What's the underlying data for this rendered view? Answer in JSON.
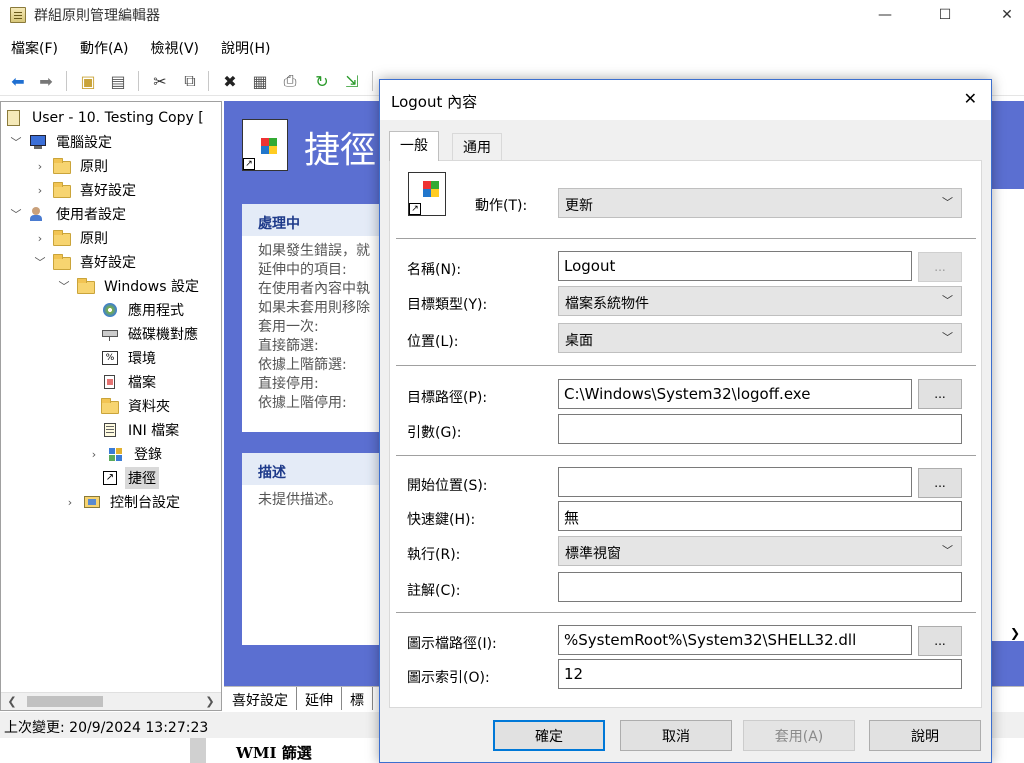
{
  "window": {
    "title": "群組原則管理編輯器"
  },
  "menu": [
    "檔案(F)",
    "動作(A)",
    "檢視(V)",
    "說明(H)"
  ],
  "tree": {
    "root": "User - 10. Testing Copy [",
    "items": [
      "電腦設定",
      "原則",
      "喜好設定",
      "使用者設定",
      "原則",
      "喜好設定",
      "Windows 設定",
      "應用程式",
      "磁碟機對應",
      "環境",
      "檔案",
      "資料夾",
      "INI 檔案",
      "登錄",
      "捷徑",
      "控制台設定"
    ]
  },
  "content": {
    "heading": "捷徑",
    "processing_title": "處理中",
    "processing_lines": [
      "如果發生錯誤，就",
      "延伸中的項目:",
      "在使用者內容中執",
      "如果未套用則移除",
      "套用一次:",
      "直接篩選:",
      "依據上階篩選:",
      "直接停用:",
      "依據上階停用:"
    ],
    "desc_title": "描述",
    "desc_text": "未提供描述。"
  },
  "bottom_tabs": [
    "喜好設定",
    "延伸",
    "標"
  ],
  "status": "上次變更: 20/9/2024 13:27:23",
  "wmi": "WMI 篩選",
  "dialog": {
    "title": "Logout 內容",
    "tabs": [
      "一般",
      "通用"
    ],
    "action_label": "動作(T):",
    "action_value": "更新",
    "name_label": "名稱(N):",
    "name_value": "Logout",
    "target_type_label": "目標類型(Y):",
    "target_type_value": "檔案系統物件",
    "location_label": "位置(L):",
    "location_value": "桌面",
    "target_path_label": "目標路徑(P):",
    "target_path_value": "C:\\Windows\\System32\\logoff.exe",
    "args_label": "引數(G):",
    "args_value": "",
    "start_in_label": "開始位置(S):",
    "start_in_value": "",
    "hotkey_label": "快速鍵(H):",
    "hotkey_value": "無",
    "run_label": "執行(R):",
    "run_value": "標準視窗",
    "comment_label": "註解(C):",
    "comment_value": "",
    "icon_path_label": "圖示檔路徑(I):",
    "icon_path_value": "%SystemRoot%\\System32\\SHELL32.dll",
    "icon_index_label": "圖示索引(O):",
    "icon_index_value": "12",
    "browse": "...",
    "buttons": {
      "ok": "確定",
      "cancel": "取消",
      "apply": "套用(A)",
      "help": "說明"
    }
  }
}
